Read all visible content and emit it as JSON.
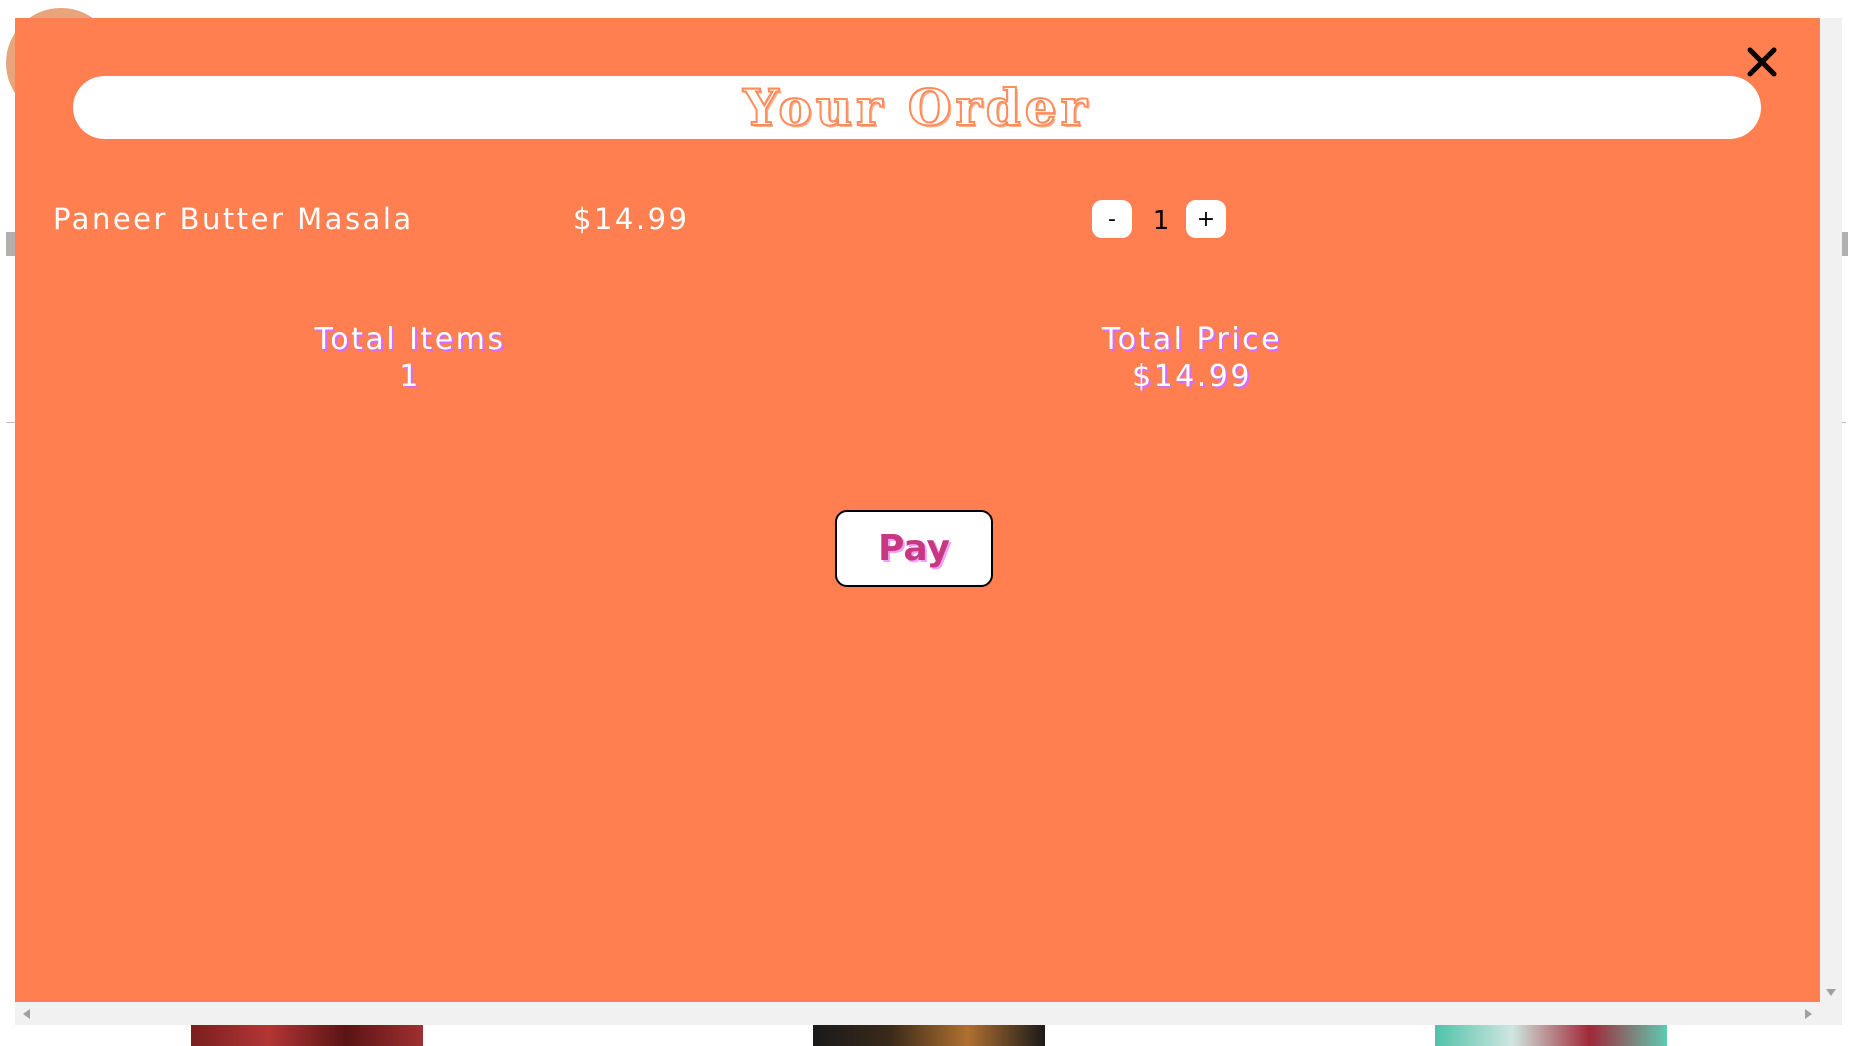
{
  "modal": {
    "title": "Your Order",
    "close_icon": "close-icon",
    "accent_color": "#ff7f50"
  },
  "order_items": [
    {
      "name": "Paneer Butter Masala",
      "price": "$14.99",
      "quantity": "1",
      "decrement_label": "-",
      "increment_label": "+"
    }
  ],
  "totals": {
    "items_label": "Total Items",
    "items_value": "1",
    "price_label": "Total Price",
    "price_value": "$14.99"
  },
  "actions": {
    "pay_label": "Pay"
  }
}
